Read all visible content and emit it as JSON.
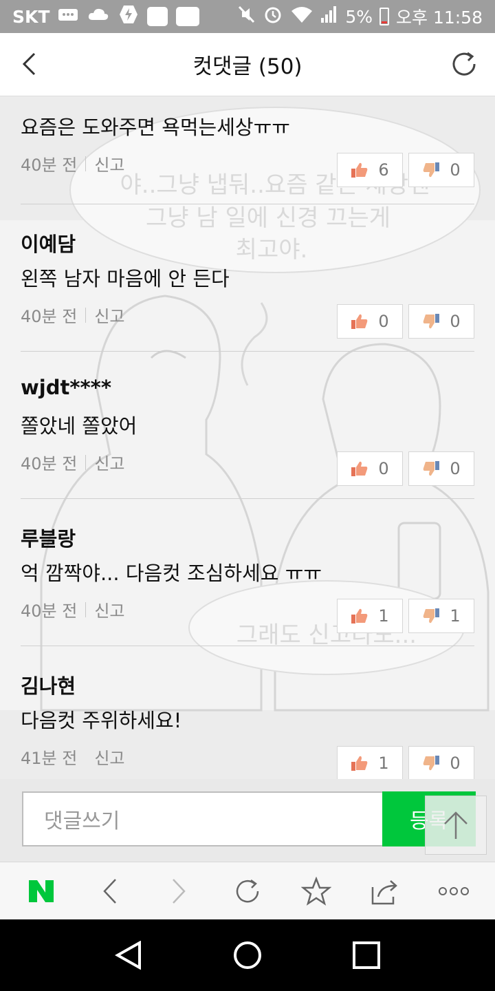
{
  "status_bar": {
    "carrier": "SKT",
    "battery": "5%",
    "time": "오후 11:58"
  },
  "header": {
    "title": "컷댓글 (50)"
  },
  "comments": [
    {
      "name": "",
      "text": "요즘은 도와주면 욕먹는세상ㅠㅠ",
      "time": "40분 전",
      "report": "신고",
      "likes": "6",
      "dislikes": "0"
    },
    {
      "name": "이예담",
      "text": "왼쪽 남자 마음에 안 든다",
      "time": "40분 전",
      "report": "신고",
      "likes": "0",
      "dislikes": "0"
    },
    {
      "name": "wjdt****",
      "text": "쫄았네 쫄았어",
      "time": "40분 전",
      "report": "신고",
      "likes": "0",
      "dislikes": "0"
    },
    {
      "name": "루블랑",
      "text": "억 깜짝야... 다음컷 조심하세요 ㅠㅠ",
      "time": "40분 전",
      "report": "신고",
      "likes": "1",
      "dislikes": "1"
    },
    {
      "name": "김나현",
      "text": "다음컷 주위하세요!",
      "time": "41분 전",
      "report": "신고",
      "likes": "1",
      "dislikes": "0"
    }
  ],
  "background_art": {
    "bubble_top_lines": [
      "야..그냥 냅둬..요즘 같은 세상엔",
      "그냥 남 일에 신경 끄는게",
      "최고야."
    ],
    "bubble_bottom": "그래도 신고라도..."
  },
  "composer": {
    "placeholder": "댓글쓰기",
    "submit_label": "등록"
  },
  "colors": {
    "accent_green": "#00c73c",
    "status_bar": "#9e9e9e"
  }
}
